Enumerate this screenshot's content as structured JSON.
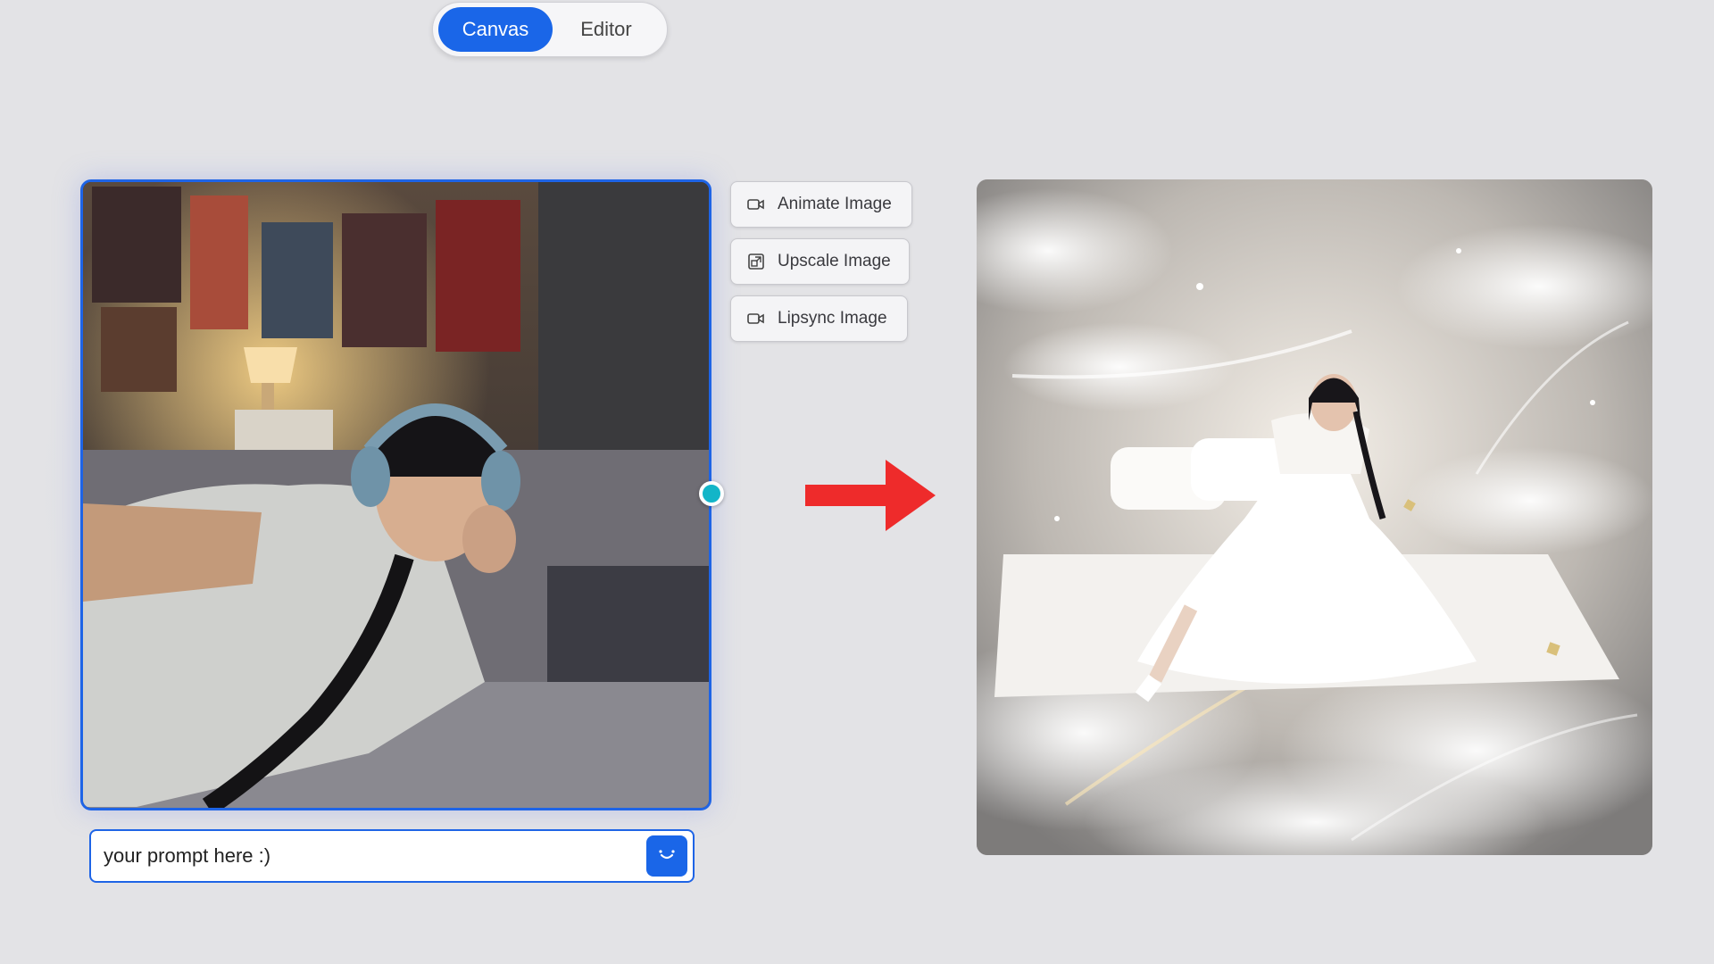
{
  "mode_toggle": {
    "active_label": "Canvas",
    "inactive_label": "Editor"
  },
  "actions": [
    {
      "label": "Animate Image",
      "icon": "video-camera-icon"
    },
    {
      "label": "Upscale Image",
      "icon": "upscale-icon"
    },
    {
      "label": "Lipsync Image",
      "icon": "video-camera-icon"
    }
  ],
  "prompt": {
    "value": "your prompt here :)",
    "send_icon": "smile-icon"
  },
  "source_image": {
    "description_icon": "photo-icon"
  },
  "result_image": {
    "description_icon": "photo-icon"
  },
  "colors": {
    "accent": "#1a66e8",
    "connector": "#12b5c8",
    "arrow": "#ee2b2b",
    "background": "#e3e3e6"
  }
}
